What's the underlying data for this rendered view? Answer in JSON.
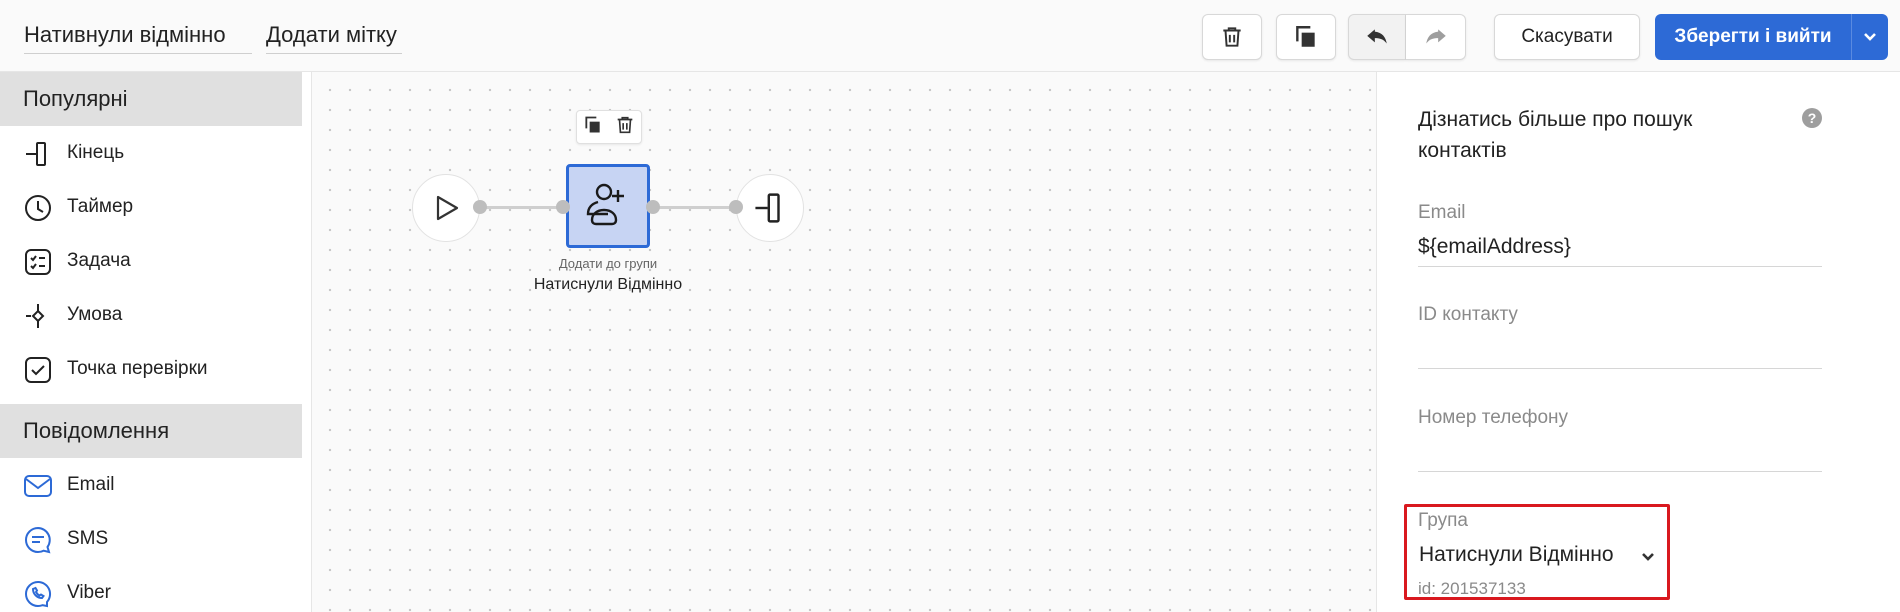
{
  "header": {
    "automation_name": "Нативнули відмінно",
    "add_tag_label": "Додати мітку",
    "cancel_label": "Скасувати",
    "save_label": "Зберегти і вийти"
  },
  "sidebar": {
    "sections": [
      {
        "title": "Популярні",
        "items": [
          {
            "label": "Кінець",
            "icon": "end-icon"
          },
          {
            "label": "Таймер",
            "icon": "timer-icon"
          },
          {
            "label": "Задача",
            "icon": "task-icon"
          },
          {
            "label": "Умова",
            "icon": "condition-icon"
          },
          {
            "label": "Точка перевірки",
            "icon": "checkpoint-icon"
          }
        ]
      },
      {
        "title": "Повідомлення",
        "items": [
          {
            "label": "Email",
            "icon": "email-icon"
          },
          {
            "label": "SMS",
            "icon": "sms-icon"
          },
          {
            "label": "Viber",
            "icon": "viber-icon"
          }
        ]
      }
    ]
  },
  "canvas": {
    "node": {
      "type_label": "Додати до групи",
      "title": "Натиснули Відмінно",
      "icon": "add-to-group-icon"
    }
  },
  "panel": {
    "learn_more": "Дізнатись більше про пошук контактів",
    "fields": {
      "email_label": "Email",
      "email_value": "${emailAddress}",
      "contact_id_label": "ID контакту",
      "contact_id_value": "",
      "phone_label": "Номер телефону",
      "phone_value": "",
      "group_label": "Група",
      "group_value": "Натиснули Відмінно",
      "group_id": "id: 201537133"
    }
  },
  "colors": {
    "accent": "#2d6ad6",
    "node_fill": "#c7d4f3",
    "highlight": "#d9181f"
  }
}
